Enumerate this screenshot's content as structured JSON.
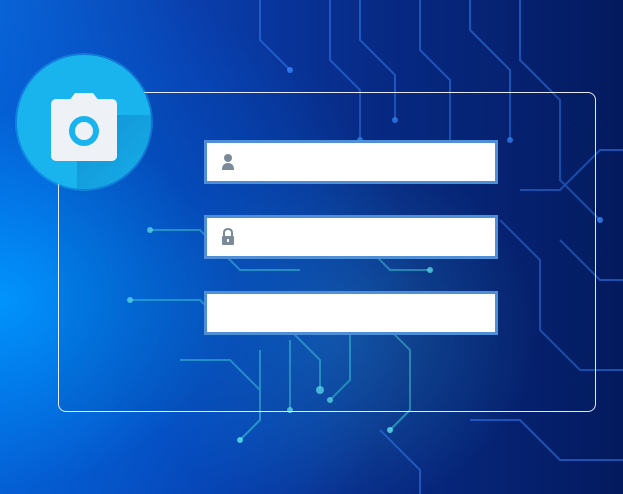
{
  "login": {
    "username": {
      "value": "",
      "placeholder": "",
      "icon": "user-icon"
    },
    "password": {
      "value": "",
      "placeholder": "",
      "icon": "lock-icon"
    },
    "extra": {
      "value": "",
      "placeholder": ""
    }
  },
  "logo": {
    "icon": "camera-icon",
    "color": "#19b3ee"
  },
  "colors": {
    "field_border": "#4f8fd8",
    "panel_border": "#ffffff"
  }
}
